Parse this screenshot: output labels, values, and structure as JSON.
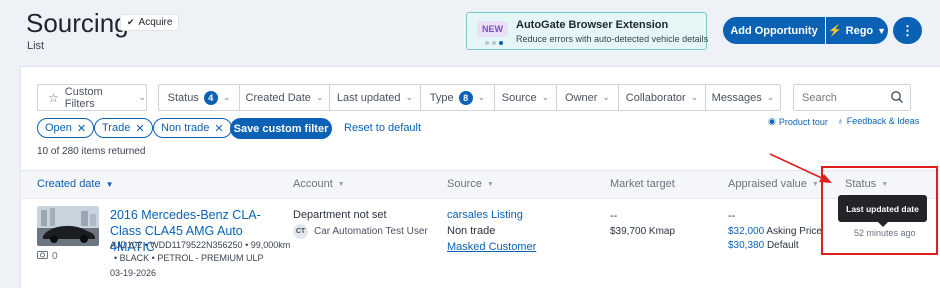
{
  "header": {
    "title": "Sourcing",
    "badge": "Acquire",
    "subtitle": "List"
  },
  "extension_banner": {
    "badge": "NEW",
    "title": "AutoGate Browser Extension",
    "subtitle": "Reduce errors with auto-detected vehicle details"
  },
  "actions": {
    "add_label": "Add Opportunity",
    "rego_label": "Rego",
    "more_label": "⋮"
  },
  "filters": {
    "custom_filters": "Custom Filters",
    "segments": [
      {
        "label": "Status",
        "count": "4"
      },
      {
        "label": "Created Date",
        "count": ""
      },
      {
        "label": "Last updated",
        "count": ""
      },
      {
        "label": "Type",
        "count": "8"
      },
      {
        "label": "Source",
        "count": ""
      },
      {
        "label": "Owner",
        "count": ""
      },
      {
        "label": "Collaborator",
        "count": ""
      },
      {
        "label": "Messages",
        "count": ""
      }
    ],
    "search_placeholder": "Search",
    "chips": [
      "Open",
      "Trade",
      "Non trade"
    ],
    "save_label": "Save custom filter",
    "reset_label": "Reset to default",
    "product_tour": "Product tour",
    "feedback": "Feedback & Ideas"
  },
  "results_text": "10 of 280 items returned",
  "table": {
    "columns": [
      "Created date",
      "Account",
      "Source",
      "Market target",
      "Appraised value",
      "Status"
    ],
    "rows": [
      {
        "vehicle_title": "2016 Mercedes-Benz CLA-Class CLA45 AMG Auto 4MATIC",
        "vehicle_details_1": "AJD102 • WDD1179522N356250 • 99,000km",
        "vehicle_details_2": "• BLACK • PETROL - PREMIUM ULP",
        "created_date": "03-19-2026",
        "photo_count": "0",
        "account_name": "Department not set",
        "account_initials": "CT",
        "account_user": "Car Automation Test User",
        "source_link": "carsales Listing",
        "source_type": "Non trade",
        "source_customer": "Masked Customer",
        "market_target_dash": "--",
        "market_target": "$39,700 Kmap",
        "appraised_dash": "--",
        "asking_price_value": "$32,000",
        "asking_price_label": "Asking Price",
        "default_value": "$30,380",
        "default_label": "Default",
        "status_tooltip": "Last updated date",
        "status_time": "52 minutes ago"
      }
    ]
  },
  "colors": {
    "primary": "#0b61b4",
    "annotation": "#e02020",
    "banner_bg": "#e5f6f7"
  }
}
